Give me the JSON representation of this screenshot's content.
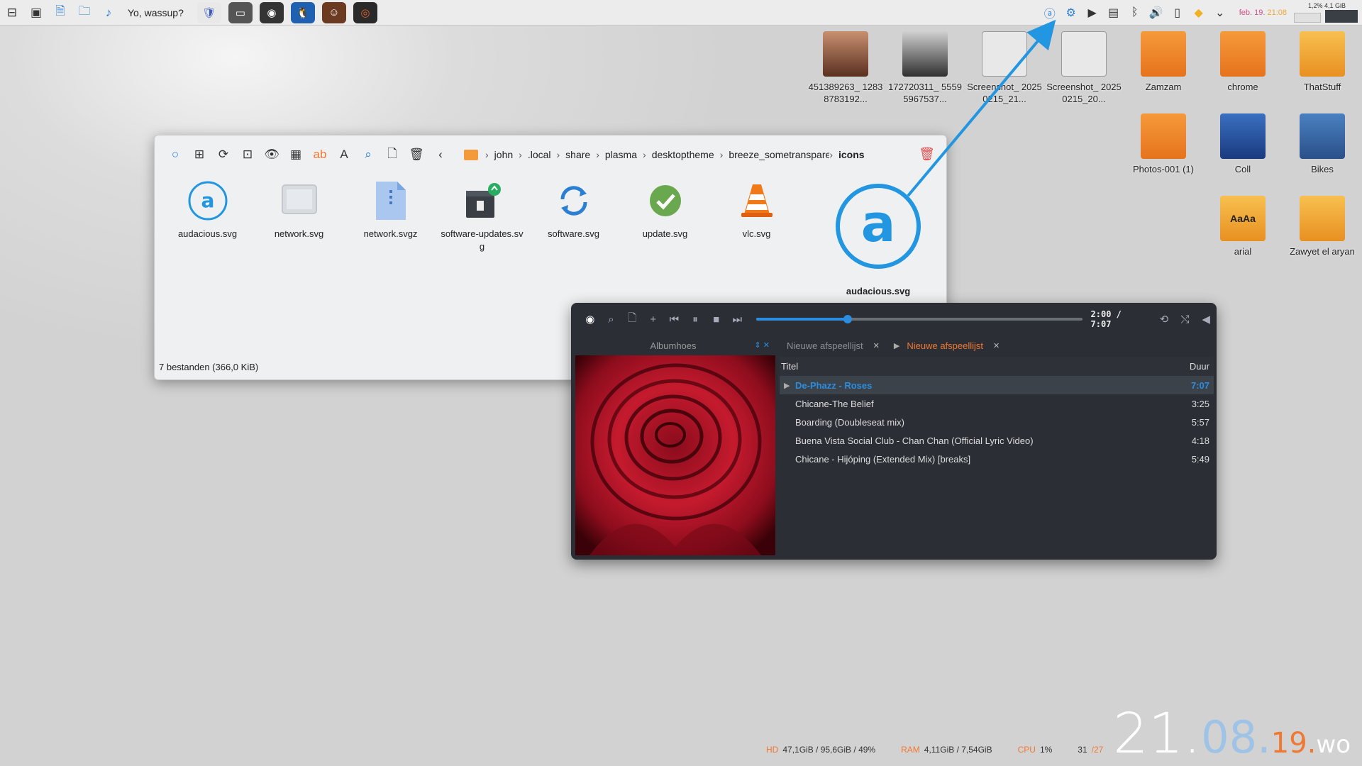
{
  "panel": {
    "greeting": "Yo, wassup?",
    "date": "feb. 19.",
    "time": "21:08",
    "mem_text": "1,2%  4,1 GiB"
  },
  "desktop_icons": [
    {
      "label": "451389263_ 12838783192..."
    },
    {
      "label": "172720311_ 55595967537..."
    },
    {
      "label": "Screenshot_ 20250215_21..."
    },
    {
      "label": "Screenshot_ 20250215_20..."
    },
    {
      "label": "Zamzam"
    },
    {
      "label": "chrome"
    },
    {
      "label": "ThatStuff"
    },
    {
      "label": "Photos-001 (1)"
    },
    {
      "label": "Coll"
    },
    {
      "label": "Bikes"
    },
    {
      "label": "arial"
    },
    {
      "label": "Zawyet el aryan"
    }
  ],
  "file_manager": {
    "breadcrumbs": [
      "john",
      ".local",
      "share",
      "plasma",
      "desktoptheme",
      "breeze_sometransparen",
      "icons"
    ],
    "files": [
      {
        "name": "audacious.svg"
      },
      {
        "name": "network.svg"
      },
      {
        "name": "network.svgz"
      },
      {
        "name": "software-updates.svg"
      },
      {
        "name": "software.svg"
      },
      {
        "name": "update.svg"
      },
      {
        "name": "vlc.svg"
      }
    ],
    "status": "7 bestanden (366,0 KiB)",
    "preview_name": "audacious.svg"
  },
  "player": {
    "time": "2:00 / 7:07",
    "progress": 0.2809,
    "albumart_label": "Albumhoes",
    "tabs": [
      {
        "label": "Nieuwe afspeellijst",
        "active": false
      },
      {
        "label": "Nieuwe afspeellijst",
        "active": true
      }
    ],
    "columns": {
      "title": "Titel",
      "duration": "Duur"
    },
    "tracks": [
      {
        "title": "De-Phazz - Roses",
        "duration": "7:07",
        "playing": true
      },
      {
        "title": "Chicane-The Belief",
        "duration": "3:25"
      },
      {
        "title": "Boarding (Doubleseat mix)",
        "duration": "5:57"
      },
      {
        "title": "Buena Vista Social Club - Chan Chan (Official Lyric Video)",
        "duration": "4:18"
      },
      {
        "title": "Chicane - Hijóping (Extended Mix) [breaks]",
        "duration": "5:49"
      }
    ]
  },
  "sysinfo": {
    "hd_label": "HD",
    "hd_value": "47,1GiB / 95,6GiB / 49%",
    "ram_label": "RAM",
    "ram_value": "4,11GiB / 7,54GiB",
    "cpu_label": "CPU",
    "cpu_value": "1%",
    "temp_value": "31",
    "temp_sep": "/27"
  },
  "clock": {
    "hours": "21",
    "minutes": "08",
    "seconds": "19",
    "day": "wo"
  }
}
